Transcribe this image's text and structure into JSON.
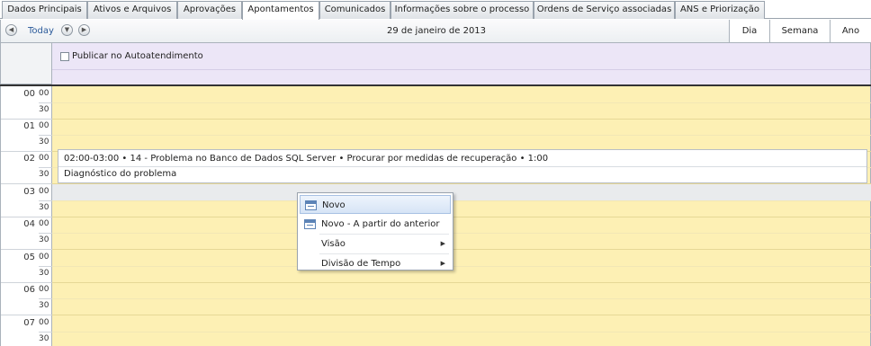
{
  "tabs": [
    {
      "label": "Dados Principais",
      "active": false
    },
    {
      "label": "Ativos e Arquivos",
      "active": false
    },
    {
      "label": "Aprovações",
      "active": false
    },
    {
      "label": "Apontamentos",
      "active": true
    },
    {
      "label": "Comunicados",
      "active": false
    },
    {
      "label": "Informações sobre o processo",
      "active": false
    },
    {
      "label": "Ordens de Serviço associadas",
      "active": false
    },
    {
      "label": "ANS e Priorização",
      "active": false
    }
  ],
  "toolbar": {
    "prev_icon": "chevron-left-icon",
    "next_icon": "chevron-right-icon",
    "today_label": "Today",
    "date_title": "29 de janeiro de 2013",
    "views": [
      "Dia",
      "Semana",
      "Ano"
    ]
  },
  "allday": {
    "checkbox_label": "Publicar no Autoatendimento",
    "checked": false
  },
  "hours": [
    "00",
    "01",
    "02",
    "03",
    "04",
    "05",
    "06",
    "07"
  ],
  "minutes": [
    "00",
    "30"
  ],
  "appointment": {
    "title": "02:00-03:00 • 14 - Problema no Banco de Dados SQL Server • Procurar por medidas de recuperação • 1:00",
    "description": "Diagnóstico do problema"
  },
  "context_menu": {
    "items": [
      {
        "label": "Novo",
        "icon": "calendar-new-icon",
        "submenu": false,
        "highlighted": true
      },
      {
        "label": "Novo - A partir do anterior",
        "icon": "calendar-new-icon",
        "submenu": false,
        "highlighted": false
      },
      {
        "label": "Visão",
        "icon": "",
        "submenu": true,
        "highlighted": false
      },
      {
        "label": "Divisão de Tempo",
        "icon": "",
        "submenu": true,
        "highlighted": false
      }
    ]
  },
  "colors": {
    "slot_background": "#fdf0b4",
    "allday_background": "#ece6f7",
    "link_color": "#2b5a9a"
  }
}
